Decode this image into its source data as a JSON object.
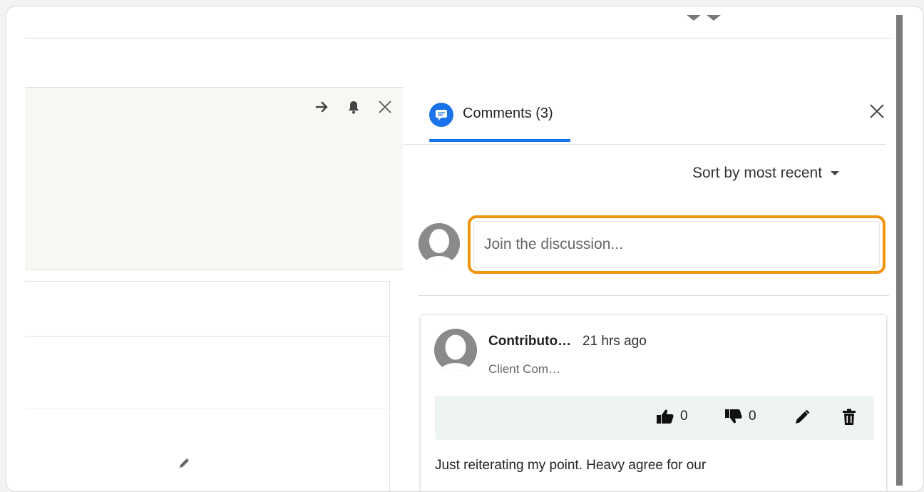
{
  "comments_panel": {
    "tab_label": "Comments (3)",
    "sort_label": "Sort by most recent",
    "input_placeholder": "Join the discussion...",
    "comment": {
      "author": "Contributo…",
      "timestamp": "21 hrs ago",
      "role": "Client Com…",
      "likes": "0",
      "dislikes": "0",
      "body": "Just reiterating my point.  Heavy agree for our"
    }
  },
  "colors": {
    "accent": "#1a73e8",
    "focus_outline": "#f2930d"
  },
  "icons": [
    "arrow-right-icon",
    "bell-icon",
    "close-icon",
    "comment-bubble-icon",
    "caret-down-icon",
    "avatar-icon",
    "thumbs-up-icon",
    "thumbs-down-icon",
    "pencil-icon",
    "trash-icon"
  ]
}
